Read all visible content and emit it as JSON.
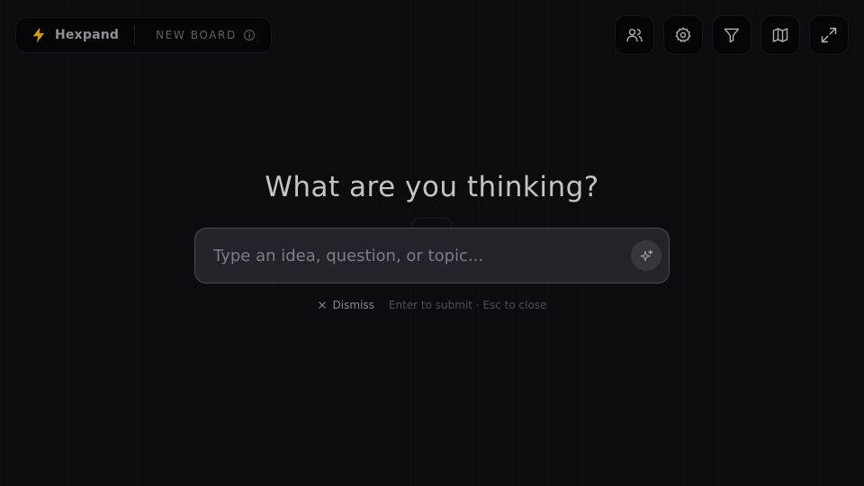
{
  "brand": {
    "name": "Hexpand",
    "board_label": "NEW BOARD",
    "accent": "#d49a1a"
  },
  "toolbar": {
    "icons": [
      "users-icon",
      "gear-icon",
      "filter-icon",
      "map-icon",
      "expand-icon"
    ]
  },
  "prompt": {
    "headline": "What are you thinking?",
    "placeholder": "Type an idea, question, or topic...",
    "value": "",
    "dismiss_label": "Dismiss",
    "hint": "Enter to submit · Esc to close"
  }
}
